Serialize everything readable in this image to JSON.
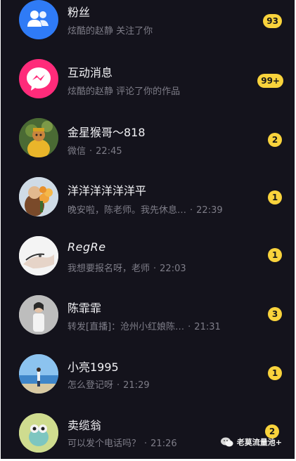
{
  "conversations": [
    {
      "name": "粉丝",
      "preview": "炫酷的赵静 关注了你",
      "time": "",
      "badge": "93",
      "avatar": "fans-icon"
    },
    {
      "name": "互动消息",
      "preview": "炫酷的赵静 评论了你的作品",
      "time": "",
      "badge": "99+",
      "avatar": "interaction-icon"
    },
    {
      "name": "金星猴哥～818",
      "preview": "微信",
      "time": "22:45",
      "badge": "2",
      "avatar": "user-avatar"
    },
    {
      "name": "洋洋洋洋洋洋平",
      "preview": "晚安啦，陈老师。我先休息…",
      "time": "22:39",
      "badge": "1",
      "avatar": "user-avatar"
    },
    {
      "name": "RegRe",
      "preview": "我想要报名呀，老师",
      "time": "22:03",
      "badge": "1",
      "avatar": "user-avatar"
    },
    {
      "name": "陈霏霏",
      "preview": "转发[直播]：沧州小红娘陈…",
      "time": "21:31",
      "badge": "3",
      "avatar": "user-avatar"
    },
    {
      "name": "小亮1995",
      "preview": "怎么登记呀",
      "time": "21:29",
      "badge": "1",
      "avatar": "user-avatar"
    },
    {
      "name": "卖缆翁",
      "preview": "可以发个电话吗？",
      "time": "21:26",
      "badge": "2",
      "avatar": "user-avatar"
    }
  ],
  "separator": "·",
  "watermark": "老莫流量池+",
  "colors": {
    "background": "#14131c",
    "badge": "#f9d33c",
    "fans_icon": "#2f7bf6",
    "interaction_icon": "#ff2b7a"
  }
}
